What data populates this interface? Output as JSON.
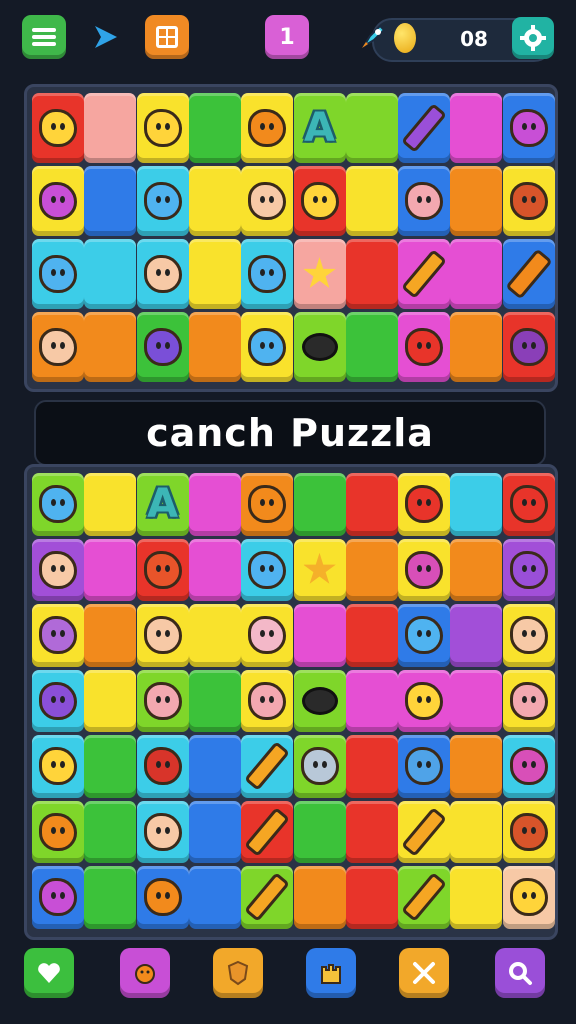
{
  "header": {
    "level": "1",
    "coins": "08",
    "buttons": [
      "menu-icon",
      "play-icon",
      "grid-icon",
      "level-badge",
      "rocket-icon",
      "coin-icon",
      "gear-icon"
    ]
  },
  "title": "canch Puzzla",
  "colors": {
    "red": "#e8342a",
    "pink_light": "#f6a6a0",
    "yellow": "#f9e22c",
    "green": "#3cc23a",
    "lime": "#7fd62a",
    "blue": "#2f7be8",
    "cyan": "#3ccde8",
    "orange": "#f28a1c",
    "magenta": "#e54fd3",
    "purple": "#a24fd8",
    "peach": "#f7c9a6",
    "light_yellow": "#ffe95a"
  },
  "board_top": {
    "rows": [
      [
        [
          "red",
          "lemon-icon"
        ],
        [
          "pink_light",
          ""
        ],
        [
          "yellow",
          "banana-icon"
        ],
        [
          "green",
          ""
        ],
        [
          "yellow",
          "orange-face-icon"
        ],
        [
          "lime",
          "letter-a-icon"
        ],
        [
          "lime",
          ""
        ],
        [
          "blue",
          "pen-icon"
        ],
        [
          "magenta",
          ""
        ],
        [
          "blue",
          "cat-face-icon"
        ]
      ],
      [
        [
          "yellow",
          "cat-face-icon"
        ],
        [
          "blue",
          ""
        ],
        [
          "cyan",
          "blue-blob-icon"
        ],
        [
          "yellow",
          ""
        ],
        [
          "yellow",
          "boy-face-icon"
        ],
        [
          "red",
          "magnifier-face-icon"
        ],
        [
          "yellow",
          ""
        ],
        [
          "blue",
          "ice-cream-icon"
        ],
        [
          "orange",
          ""
        ],
        [
          "yellow",
          "football-icon"
        ]
      ],
      [
        [
          "cyan",
          "blue-blob-icon"
        ],
        [
          "cyan",
          ""
        ],
        [
          "cyan",
          "boy-face-icon"
        ],
        [
          "yellow",
          ""
        ],
        [
          "cyan",
          "blue-blob-icon"
        ],
        [
          "pink_light",
          "star-icon"
        ],
        [
          "red",
          ""
        ],
        [
          "magenta",
          "pencil-icon"
        ],
        [
          "magenta",
          ""
        ],
        [
          "blue",
          "carrot-icon"
        ]
      ],
      [
        [
          "orange",
          "boy-face-icon"
        ],
        [
          "orange",
          ""
        ],
        [
          "green",
          "eggplant-icon"
        ],
        [
          "orange",
          ""
        ],
        [
          "yellow",
          "blue-blob-icon"
        ],
        [
          "lime",
          "rock-icon"
        ],
        [
          "green",
          ""
        ],
        [
          "magenta",
          "strawberry-icon"
        ],
        [
          "orange",
          ""
        ],
        [
          "red",
          "planet-icon"
        ]
      ]
    ]
  },
  "board_bottom": {
    "rows": [
      [
        [
          "lime",
          "blue-blob-icon"
        ],
        [
          "yellow",
          ""
        ],
        [
          "lime",
          "letter-a-icon"
        ],
        [
          "magenta",
          ""
        ],
        [
          "orange",
          "orange-face-icon"
        ],
        [
          "green",
          ""
        ],
        [
          "red",
          ""
        ],
        [
          "yellow",
          "strawberry-icon"
        ],
        [
          "cyan",
          ""
        ],
        [
          "red",
          "red-blob-icon"
        ]
      ],
      [
        [
          "purple",
          "girl-face-icon"
        ],
        [
          "magenta",
          ""
        ],
        [
          "red",
          "red-cat-icon"
        ],
        [
          "magenta",
          ""
        ],
        [
          "cyan",
          "blue-blob-icon"
        ],
        [
          "yellow",
          "stars-icon"
        ],
        [
          "orange",
          ""
        ],
        [
          "yellow",
          "magenta-blob-icon"
        ],
        [
          "orange",
          ""
        ],
        [
          "purple",
          "purple-blob-icon"
        ]
      ],
      [
        [
          "yellow",
          "purple-face-icon"
        ],
        [
          "orange",
          ""
        ],
        [
          "yellow",
          "boy-face-icon"
        ],
        [
          "yellow",
          ""
        ],
        [
          "yellow",
          "pink-face-icon"
        ],
        [
          "magenta",
          ""
        ],
        [
          "red",
          ""
        ],
        [
          "blue",
          "blue-blob-icon"
        ],
        [
          "purple",
          ""
        ],
        [
          "yellow",
          "girl-face-icon"
        ]
      ],
      [
        [
          "cyan",
          "eggplant-face-icon"
        ],
        [
          "yellow",
          ""
        ],
        [
          "lime",
          "ice-cream-icon"
        ],
        [
          "green",
          ""
        ],
        [
          "yellow",
          "ice-cream-icon"
        ],
        [
          "lime",
          "rock-icon"
        ],
        [
          "magenta",
          ""
        ],
        [
          "magenta",
          "lemon-icon"
        ],
        [
          "magenta",
          ""
        ],
        [
          "yellow",
          "hand-icon"
        ]
      ],
      [
        [
          "cyan",
          "yellow-face-icon"
        ],
        [
          "green",
          ""
        ],
        [
          "cyan",
          "chili-icon"
        ],
        [
          "blue",
          ""
        ],
        [
          "cyan",
          "pencil-icon"
        ],
        [
          "lime",
          "dice-icon"
        ],
        [
          "red",
          ""
        ],
        [
          "blue",
          "bomb-icon"
        ],
        [
          "orange",
          ""
        ],
        [
          "cyan",
          "magenta-blob-icon"
        ]
      ],
      [
        [
          "lime",
          "orange-face-icon"
        ],
        [
          "green",
          ""
        ],
        [
          "cyan",
          "boy-face-icon"
        ],
        [
          "blue",
          ""
        ],
        [
          "red",
          "pencil-icon"
        ],
        [
          "green",
          ""
        ],
        [
          "red",
          ""
        ],
        [
          "yellow",
          "pencil-icon"
        ],
        [
          "yellow",
          ""
        ],
        [
          "yellow",
          "football-icon"
        ]
      ],
      [
        [
          "blue",
          "cat-face-icon"
        ],
        [
          "green",
          ""
        ],
        [
          "blue",
          "orange-cat-icon"
        ],
        [
          "blue",
          ""
        ],
        [
          "lime",
          "pencil-icon"
        ],
        [
          "orange",
          ""
        ],
        [
          "red",
          ""
        ],
        [
          "lime",
          "pencil-icon"
        ],
        [
          "yellow",
          ""
        ],
        [
          "peach",
          "yellow-face-icon"
        ]
      ]
    ]
  },
  "footer": {
    "buttons": [
      {
        "name": "heart-icon",
        "color": "#3cbf3e"
      },
      {
        "name": "character-icon",
        "color": "#c84fd6"
      },
      {
        "name": "shield-icon",
        "color": "#f2a82a"
      },
      {
        "name": "castle-icon",
        "color": "#2f7be8"
      },
      {
        "name": "tools-icon",
        "color": "#f2a82a"
      },
      {
        "name": "search-icon",
        "color": "#9a4fd8"
      }
    ]
  }
}
